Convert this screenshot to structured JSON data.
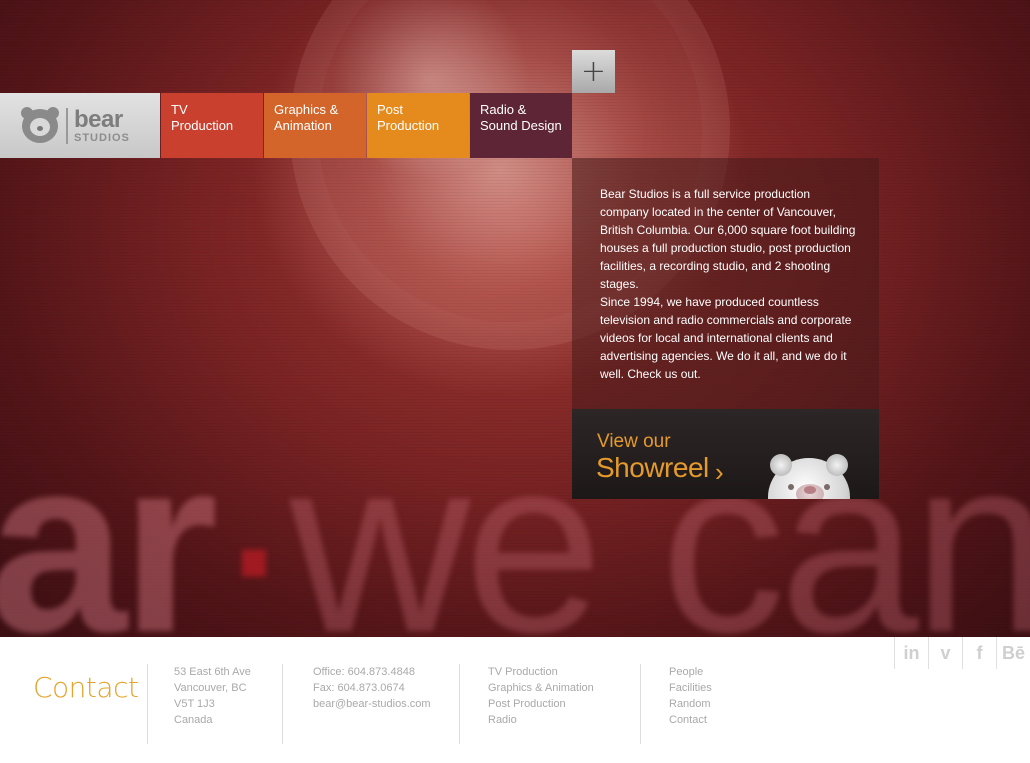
{
  "logo": {
    "line1": "bear",
    "line2": "STUDIOS"
  },
  "nav": [
    {
      "line1": "TV",
      "line2": "Production"
    },
    {
      "line1": "Graphics &",
      "line2": "Animation"
    },
    {
      "line1": "Post",
      "line2": "Production"
    },
    {
      "line1": "Radio &",
      "line2": "Sound Design"
    }
  ],
  "plus": {
    "label": "+"
  },
  "background_text": {
    "part1": "ar",
    "part2": "·",
    "part3": "we can c"
  },
  "info": {
    "para1": "Bear Studios is a full service production company located in the center of Vancouver, British Columbia. Our 6,000 square foot building houses a full production studio, post production facilities, a recording studio, and 2 shooting stages.",
    "para2": "Since 1994, we have produced countless television and radio commercials and corporate videos for local and international clients and advertising agencies. We do it all, and we do it well. Check us out."
  },
  "showreel": {
    "line1": "View our",
    "line2": "Showreel",
    "chevron": "›"
  },
  "footer": {
    "title": "Contact",
    "address": [
      "53 East 6th Ave",
      "Vancouver, BC",
      "V5T 1J3",
      "Canada"
    ],
    "phone": [
      "Office: 604.873.4848",
      "Fax: 604.873.0674",
      "bear@bear-studios.com"
    ],
    "services": [
      "TV Production",
      "Graphics & Animation",
      "Post Production",
      "Radio"
    ],
    "links": [
      "People",
      "Facilities",
      "Random",
      "Contact"
    ]
  },
  "social": [
    {
      "icon": "linkedin-icon",
      "label": "in"
    },
    {
      "icon": "vimeo-icon",
      "label": "v"
    },
    {
      "icon": "facebook-icon",
      "label": "f"
    },
    {
      "icon": "behance-icon",
      "label": "Bē"
    }
  ],
  "colors": {
    "tv": "#c9402f",
    "graphics": "#d4652a",
    "post": "#e58a1c",
    "radio": "#5d2535",
    "accent": "#e59a2c"
  }
}
